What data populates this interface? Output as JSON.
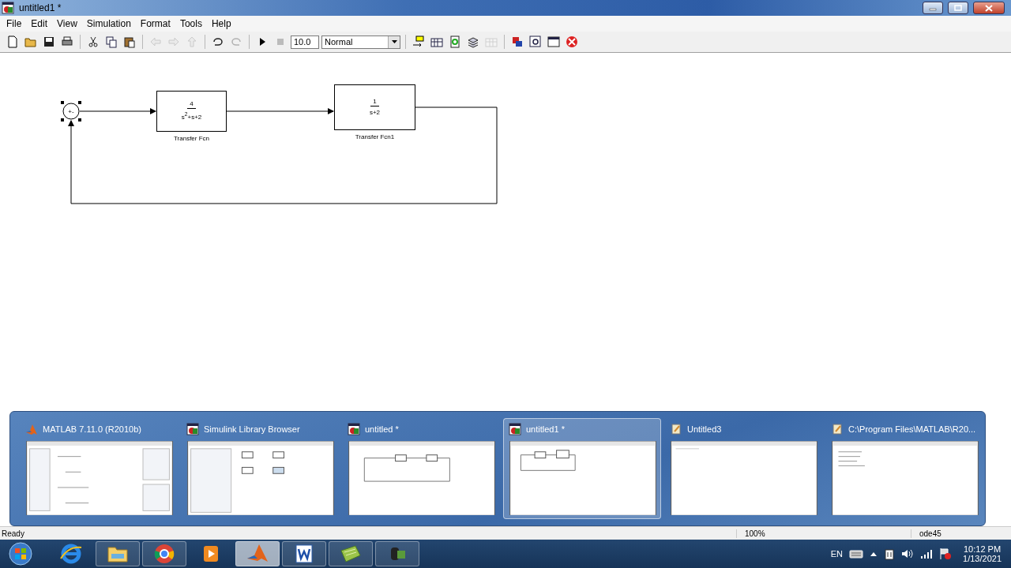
{
  "window": {
    "title": "untitled1 *"
  },
  "menu": [
    "File",
    "Edit",
    "View",
    "Simulation",
    "Format",
    "Tools",
    "Help"
  ],
  "toolbar": [
    {
      "kind": "button",
      "disabled": false
    },
    {
      "kind": "button",
      "disabled": false
    },
    {
      "kind": "button",
      "disabled": false
    },
    {
      "kind": "button",
      "disabled": false
    },
    {
      "kind": "separator"
    },
    {
      "kind": "button",
      "disabled": false
    },
    {
      "kind": "button",
      "disabled": false
    },
    {
      "kind": "button",
      "disabled": false
    },
    {
      "kind": "separator"
    },
    {
      "kind": "button",
      "disabled": true
    },
    {
      "kind": "button",
      "disabled": true
    },
    {
      "kind": "button",
      "disabled": true
    },
    {
      "kind": "separator"
    },
    {
      "kind": "button",
      "disabled": false
    },
    {
      "kind": "button",
      "disabled": true
    },
    {
      "kind": "separator"
    },
    {
      "kind": "button",
      "disabled": false
    },
    {
      "kind": "button",
      "disabled": true
    },
    {
      "kind": "field",
      "value": "10.0"
    },
    {
      "kind": "dropdown",
      "value": "Normal"
    },
    {
      "kind": "separator"
    },
    {
      "kind": "button",
      "disabled": false
    },
    {
      "kind": "button",
      "disabled": false
    },
    {
      "kind": "button",
      "disabled": false
    },
    {
      "kind": "button",
      "disabled": false
    },
    {
      "kind": "button",
      "disabled": true
    },
    {
      "kind": "separator"
    },
    {
      "kind": "button",
      "disabled": false
    },
    {
      "kind": "button",
      "disabled": false
    },
    {
      "kind": "button",
      "disabled": false
    },
    {
      "kind": "button",
      "disabled": false
    }
  ],
  "diagram": {
    "blocks": [
      {
        "kind": "sum",
        "signs": "+-",
        "selected": true
      },
      {
        "kind": "transfer_fcn",
        "numerator": "4",
        "denominator": "s$^{2}$+s+2",
        "label": "Transfer Fcn",
        "selected": false
      },
      {
        "kind": "transfer_fcn",
        "numerator": "1",
        "denominator": "s+2",
        "label": "Transfer Fcn1",
        "selected": false
      }
    ]
  },
  "status_bar": [
    "Ready",
    "100%",
    "ode45"
  ],
  "task_switcher": [
    {
      "title": "MATLAB  7.11.0 (R2010b)",
      "selected": false
    },
    {
      "title": "Simulink Library Browser",
      "selected": false
    },
    {
      "title": "untitled *",
      "selected": false
    },
    {
      "title": "untitled1 *",
      "selected": true
    },
    {
      "title": "Untitled3",
      "selected": false
    },
    {
      "title": "C:\\Program Files\\MATLAB\\R20...",
      "selected": false
    }
  ],
  "taskbar": [
    {
      "running": false,
      "selected": false
    },
    {
      "running": true,
      "selected": false
    },
    {
      "running": true,
      "selected": false
    },
    {
      "running": false,
      "selected": false
    },
    {
      "running": true,
      "selected": true
    },
    {
      "running": true,
      "selected": false
    },
    {
      "running": true,
      "selected": false
    },
    {
      "running": true,
      "selected": false
    }
  ],
  "tray": {
    "language": "EN",
    "time": "10:12 PM",
    "date": "1/13/2021"
  }
}
